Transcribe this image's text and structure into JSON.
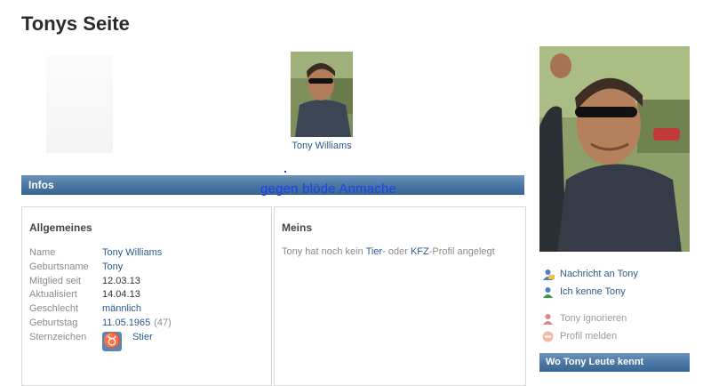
{
  "page": {
    "title": "Tonys Seite"
  },
  "thumbnail": {
    "name": "Tony Williams"
  },
  "infos_header": "Infos",
  "overlay_text": "gegen blöde Anmache",
  "allgemeines": {
    "title": "Allgemeines",
    "rows": [
      {
        "label": "Name",
        "value": "Tony Williams"
      },
      {
        "label": "Geburtsname",
        "value": "Tony"
      },
      {
        "label": "Mitglied seit",
        "value": "12.03.13"
      },
      {
        "label": "Aktualisiert",
        "value": "14.04.13"
      },
      {
        "label": "Geschlecht",
        "value": "männlich"
      },
      {
        "label": "Geburtstag",
        "value": "11.05.1965",
        "extra": "(47)"
      },
      {
        "label": "Sternzeichen",
        "value": "Stier",
        "icon": "taurus-icon"
      }
    ]
  },
  "meins": {
    "title": "Meins",
    "text_before": "Tony hat noch kein ",
    "link1": "Tier",
    "text_mid": "- oder ",
    "link2": "KFZ",
    "text_after": "-Profil angelegt"
  },
  "actions": [
    {
      "label": "Nachricht an Tony",
      "icon": "message-icon"
    },
    {
      "label": "Ich kenne Tony",
      "icon": "contact-icon"
    },
    {
      "label": "Tony ignorieren",
      "icon": "ignore-icon"
    },
    {
      "label": "Profil melden",
      "icon": "report-icon"
    }
  ],
  "leute_header": "Wo Tony Leute kennt",
  "colors": {
    "accent": "#4a76a3",
    "link": "#2a5a8a",
    "overlay": "#1c3ff0"
  }
}
